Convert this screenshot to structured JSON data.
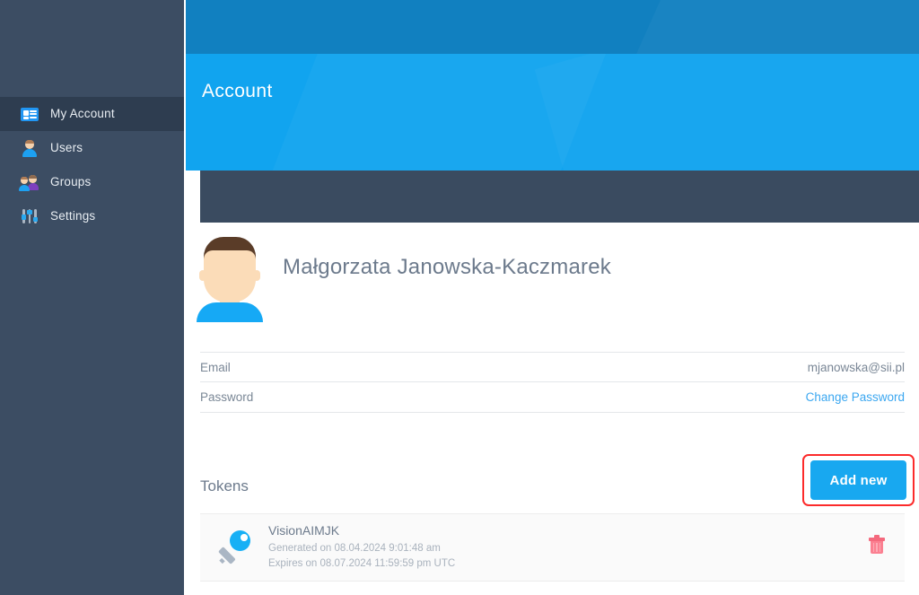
{
  "sidebar": {
    "items": [
      {
        "label": "My Account",
        "icon": "id-card-icon",
        "active": true
      },
      {
        "label": "Users",
        "icon": "user-icon",
        "active": false
      },
      {
        "label": "Groups",
        "icon": "users-group-icon",
        "active": false
      },
      {
        "label": "Settings",
        "icon": "sliders-icon",
        "active": false
      }
    ]
  },
  "header": {
    "title": "Account"
  },
  "profile": {
    "name": "Małgorzata Janowska-Kaczmarek",
    "avatar_icon": "avatar-icon"
  },
  "details": {
    "rows": [
      {
        "label": "Email",
        "value": "mjanowska@sii.pl",
        "is_link": false
      },
      {
        "label": "Password",
        "value": "Change Password",
        "is_link": true
      }
    ]
  },
  "tokens": {
    "title": "Tokens",
    "add_button_label": "Add new",
    "items": [
      {
        "name": "VisionAIMJK",
        "generated": "Generated on 08.04.2024 9:01:48 am",
        "expires": "Expires on 08.07.2024 11:59:59 pm UTC",
        "key_icon": "key-icon",
        "delete_icon": "trash-icon"
      }
    ]
  },
  "colors": {
    "sidebar_bg": "#3c4d63",
    "sidebar_active_bg": "#2e3d50",
    "topbar_blue": "#1180c0",
    "banner_blue": "#11a4ef",
    "tabstrip_dark": "#3a4b60",
    "accent_blue": "#18a8f0",
    "link_blue": "#3ba7f0",
    "highlight_red": "#fc2b2b",
    "trash_red": "#fb8091",
    "text_muted": "#7a8796"
  }
}
